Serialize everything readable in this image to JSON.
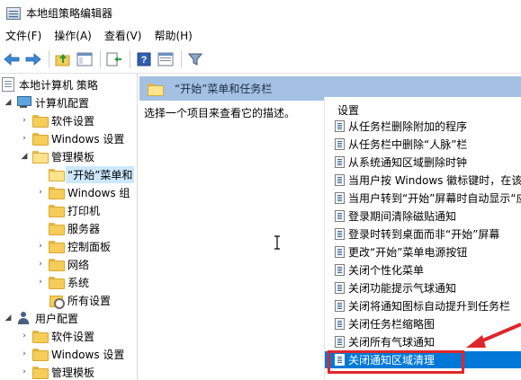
{
  "window": {
    "title": "本地组策略编辑器"
  },
  "menu": [
    "文件(F)",
    "操作(A)",
    "查看(V)",
    "帮助(H)"
  ],
  "tree": {
    "root": "本地计算机 策略",
    "computer_config": "计算机配置",
    "computer_children": {
      "software": "软件设置",
      "windows": "Windows 设置",
      "admin_templates": "管理模板"
    },
    "admin_children": [
      "“开始”菜单和",
      "Windows 组",
      "打印机",
      "服务器",
      "控制面板",
      "网络",
      "系统",
      "所有设置"
    ],
    "user_config": "用户配置",
    "user_children": [
      "软件设置",
      "Windows 设置",
      "管理模板"
    ]
  },
  "right_panel": {
    "header_title": "“开始”菜单和任务栏",
    "description": "选择一个项目来查看它的描述。",
    "column_header": "设置",
    "settings": [
      "从任务栏删除附加的程序",
      "从任务栏中删除“人脉”栏",
      "从系统通知区域删除时钟",
      "当用户按 Windows 徽标键时，在该用",
      "当用户转到“开始”屏幕时自动显示“应用",
      "登录期间清除磁贴通知",
      "登录时转到桌面而非“开始”屏幕",
      "更改“开始”菜单电源按钮",
      "关闭个性化菜单",
      "关闭功能提示气球通知",
      "关闭将通知图标自动提升到任务栏",
      "关闭任务栏缩略图",
      "关闭所有气球通知",
      "关闭通知区域清理"
    ],
    "selected_index": 13
  },
  "colors": {
    "header_bg": "#a4c1e3",
    "selection": "#0078d7",
    "highlight": "#e0262c"
  }
}
